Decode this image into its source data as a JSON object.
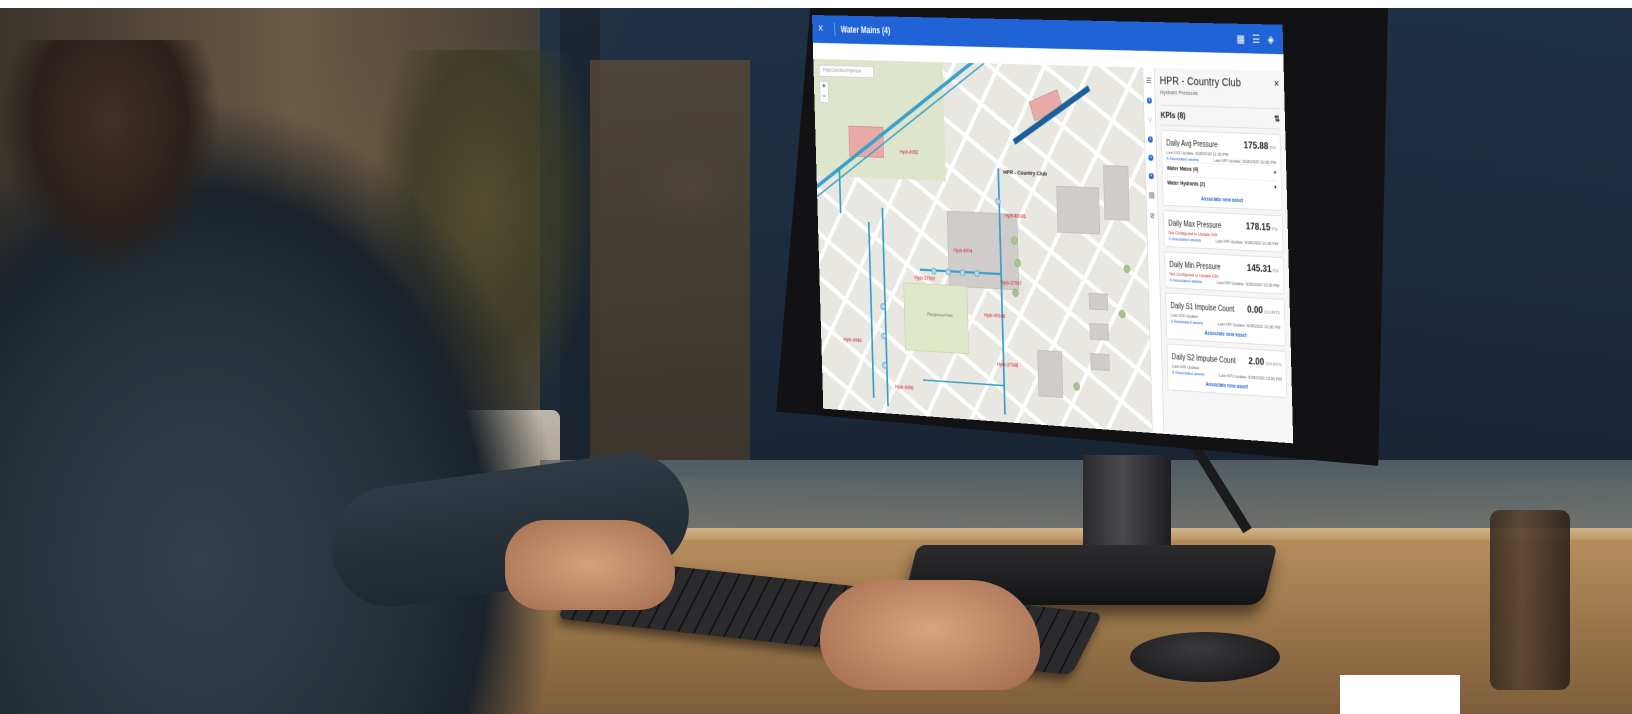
{
  "screen": {
    "header": {
      "close": "×",
      "title": "Water Mains (4)",
      "icons": [
        "grid-icon",
        "list-icon",
        "layers-icon"
      ]
    },
    "map": {
      "search_placeholder": "Pipe/Junction/Hydrant",
      "zoom_in": "+",
      "zoom_out": "−",
      "selected_label": "HPR - Country Club",
      "park_label": "Playground Park",
      "hydrant_labels": [
        "Hydr-4952",
        "Hydr-4974",
        "Hydr-37992",
        "Hydr-49146",
        "Hydr-37997",
        "Hydr-49148",
        "Hydr-4946",
        "Hydr-4956",
        "Hydr-37948"
      ]
    },
    "rail": {
      "badges": [
        "4",
        "2",
        "4",
        "4"
      ]
    },
    "panel": {
      "title": "HPR - Country Club",
      "subtitle": "Hydrant Pressure",
      "close": "×",
      "kpis_label": "KPIs (8)",
      "assoc_label": "Associate new asset",
      "cards": [
        {
          "name": "Daily Avg Pressure",
          "value": "175.88",
          "unit": "PSI",
          "gis": "Last GIS Update: 9/28/2020 11:00 PM",
          "assets": "6 Associated assets",
          "kpi": "Last KPI Update: 9/28/2020 10:00 PM",
          "groups": [
            "Water Mains (4)",
            "Water Hydrants (2)"
          ]
        },
        {
          "name": "Daily Max Pressure",
          "value": "178.15",
          "unit": "PSI",
          "gis": "Not Configured to Update GIS",
          "assets": "0 Associated assets",
          "kpi": "Last KPI Update: 9/28/2020 10:00 PM"
        },
        {
          "name": "Daily Min Pressure",
          "value": "145.31",
          "unit": "PSI",
          "gis": "Not Configured to Update GIS",
          "assets": "0 Associated assets",
          "kpi": "Last KPI Update: 9/28/2020 10:00 PM"
        },
        {
          "name": "Daily S1 Impulse Count",
          "value": "0.00",
          "unit": "COUNTS",
          "gis": "Last GIS Update:",
          "assets": "0 Associated assets",
          "kpi": "Last KPI Update: 9/28/2020 10:00 PM"
        },
        {
          "name": "Daily S2 Impulse Count",
          "value": "2.00",
          "unit": "COUNTS",
          "gis": "Last GIS Update:",
          "assets": "0 Associated assets",
          "kpi": "Last KPI Update: 9/28/2020 10:00 PM"
        }
      ]
    }
  },
  "colors": {
    "header_blue": "#1f63d6",
    "pipe_blue": "#3aa0c8",
    "highlight_pipe": "#1a5f9a",
    "alert_red": "#d32020"
  }
}
